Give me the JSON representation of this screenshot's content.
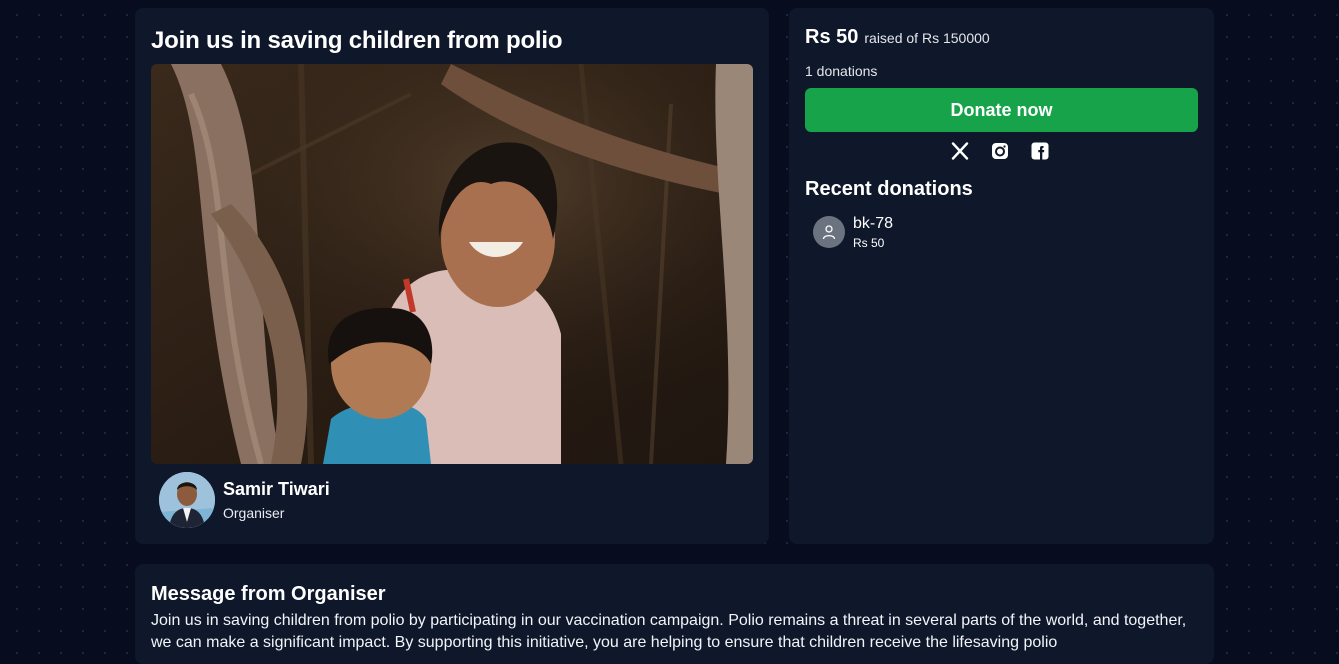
{
  "campaign": {
    "title": "Join us in saving children from polio",
    "organiser_name": "Samir Tiwari",
    "organiser_role": "Organiser"
  },
  "fundraising": {
    "raised_amount": "Rs 50",
    "raised_of": "raised of Rs 150000",
    "donation_count": "1 donations",
    "donate_label": "Donate now"
  },
  "share_icons": [
    "x-twitter-icon",
    "instagram-icon",
    "facebook-icon"
  ],
  "recent": {
    "title": "Recent donations",
    "donations": [
      {
        "name": "bk-78",
        "amount": "Rs 50"
      }
    ]
  },
  "message": {
    "title": "Message from Organiser",
    "body": "Join us in saving children from polio by participating in our vaccination campaign. Polio remains a threat in several parts of the world, and together, we can make a significant impact. By supporting this initiative, you are helping to ensure that children receive the lifesaving polio"
  },
  "colors": {
    "background": "#070d1f",
    "card": "#0f172a",
    "donate_button": "#16a34a",
    "user_avatar": "#6b7280"
  }
}
